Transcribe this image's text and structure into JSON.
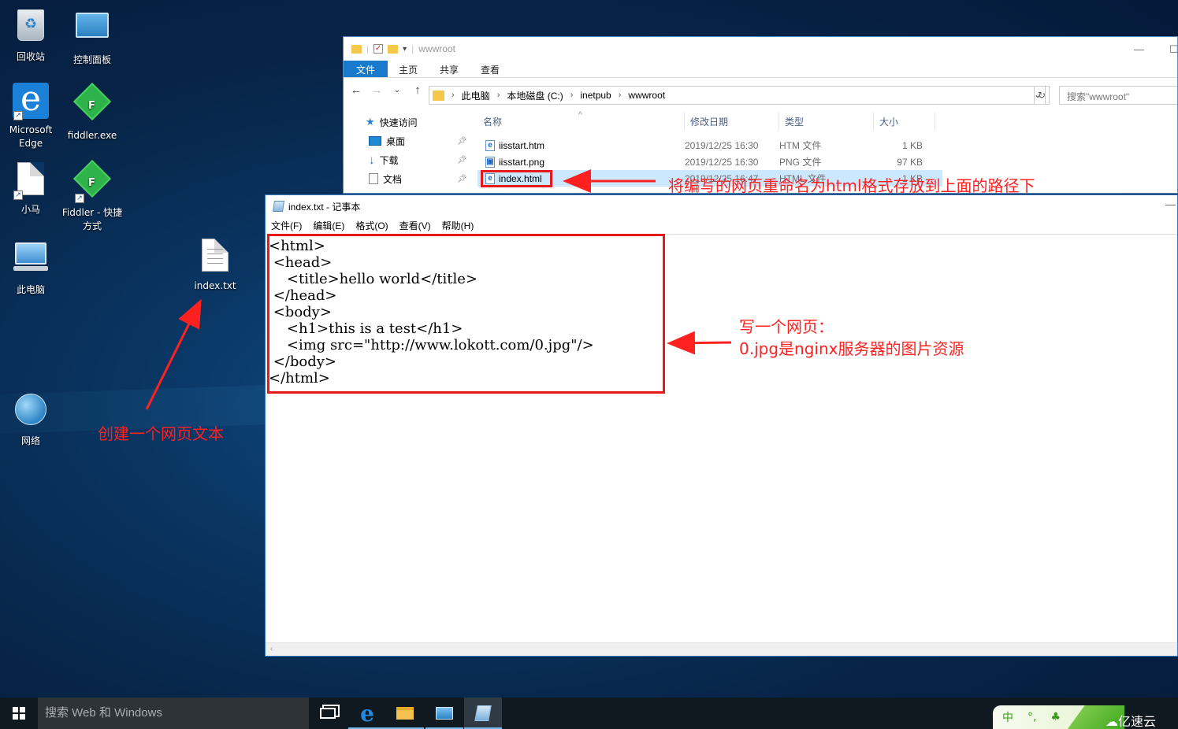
{
  "desktop": {
    "icons": [
      {
        "label": "回收站"
      },
      {
        "label": "控制面板"
      },
      {
        "label": "Microsoft Edge"
      },
      {
        "label": "fiddler.exe"
      },
      {
        "label": "小马"
      },
      {
        "label": "Fiddler - 快捷方式"
      },
      {
        "label": "此电脑"
      },
      {
        "label": "index.txt"
      },
      {
        "label": "网络"
      }
    ]
  },
  "explorer": {
    "title": "wwwroot",
    "ribbon_tabs": [
      "文件",
      "主页",
      "共享",
      "查看"
    ],
    "breadcrumb": [
      "此电脑",
      "本地磁盘 (C:)",
      "inetpub",
      "wwwroot"
    ],
    "search_placeholder": "搜索\"wwwroot\"",
    "nav": {
      "quick_access": "快速访问",
      "items": [
        "桌面",
        "下载",
        "文档"
      ]
    },
    "columns": [
      "名称",
      "修改日期",
      "类型",
      "大小"
    ],
    "files": [
      {
        "name": "iisstart.htm",
        "date": "2019/12/25 16:30",
        "type": "HTM 文件",
        "size": "1 KB",
        "icon": "e"
      },
      {
        "name": "iisstart.png",
        "date": "2019/12/25 16:30",
        "type": "PNG 文件",
        "size": "97 KB",
        "icon": "▣"
      },
      {
        "name": "index.html",
        "date": "2019/12/25 16:47",
        "type": "HTML 文件",
        "size": "1 KB",
        "icon": "e"
      }
    ]
  },
  "notepad": {
    "title": "index.txt - 记事本",
    "menu": [
      "文件(F)",
      "编辑(E)",
      "格式(O)",
      "查看(V)",
      "帮助(H)"
    ],
    "content": "<html>\n <head>\n    <title>hello world</title>\n </head>\n <body>\n    <h1>this is a test</h1>\n    <img src=\"http://www.lokott.com/0.jpg\"/>\n </body>\n</html>"
  },
  "annotations": {
    "rename": "将编写的网页重命名为html格式存放到上面的路径下",
    "write_line1": "写一个网页：",
    "write_line2": "0.jpg是nginx服务器的图片资源",
    "create": "创建一个网页文本"
  },
  "taskbar": {
    "search_placeholder": "搜索 Web 和 Windows",
    "ime": "中",
    "ime_punct": "°,"
  },
  "watermark": "亿速云",
  "colors": {
    "annotation": "#ff2020",
    "ribbon_file_tab": "#1979ca",
    "selection": "#cce8ff"
  }
}
